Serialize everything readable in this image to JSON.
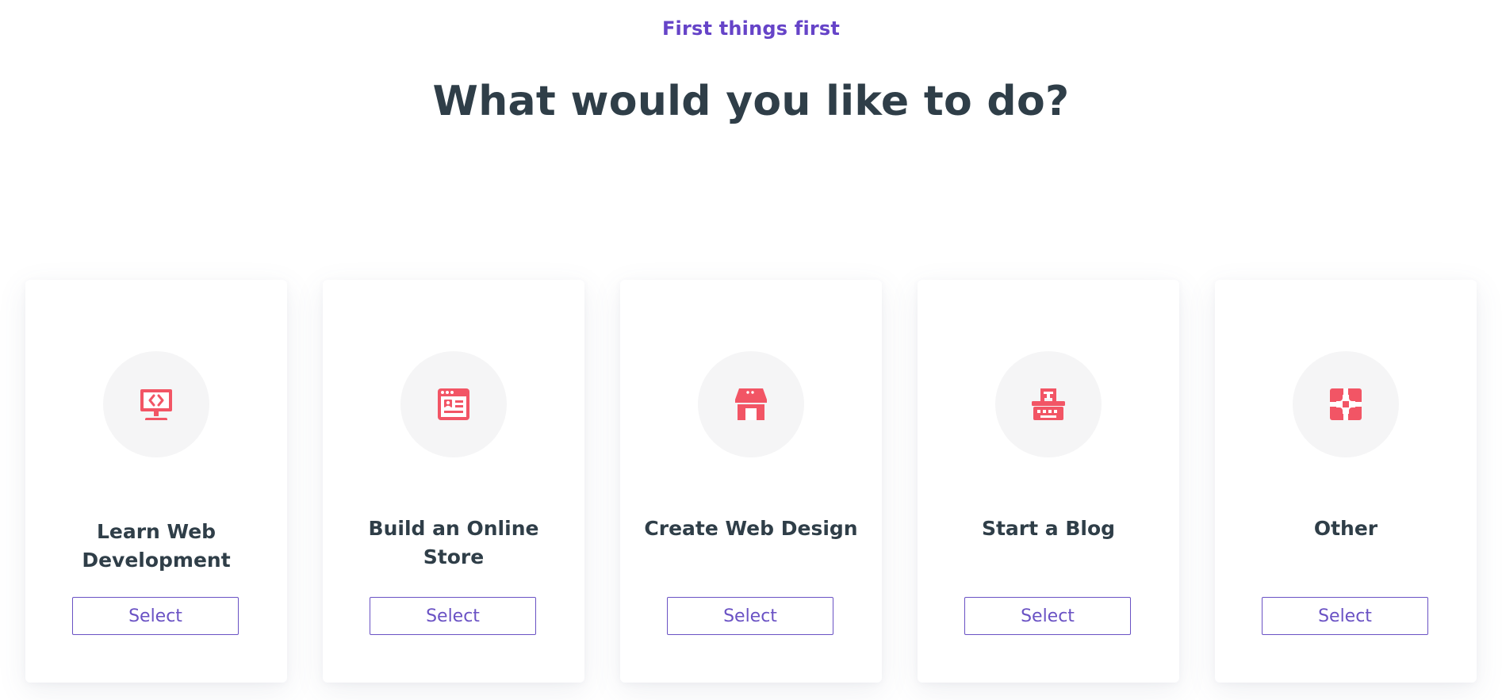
{
  "header": {
    "eyebrow": "First things first",
    "headline": "What would you like to do?"
  },
  "colors": {
    "accent": "#6644c8",
    "icon": "#f25565",
    "heading": "#2f3e48"
  },
  "options": [
    {
      "title": "Learn Web Development",
      "icon": "monitor-code-icon",
      "button": "Select"
    },
    {
      "title": "Build an Online Store",
      "icon": "browser-window-icon",
      "button": "Select"
    },
    {
      "title": "Create Web Design",
      "icon": "storefront-icon",
      "button": "Select"
    },
    {
      "title": "Start a Blog",
      "icon": "typewriter-icon",
      "button": "Select"
    },
    {
      "title": "Other",
      "icon": "puzzle-piece-icon",
      "button": "Select"
    }
  ]
}
